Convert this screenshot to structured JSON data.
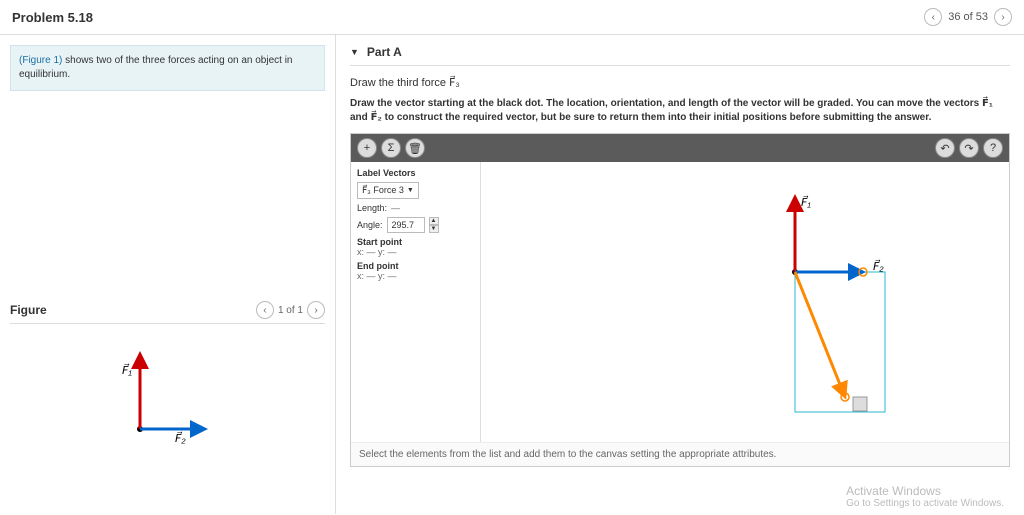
{
  "header": {
    "title": "Problem 5.18",
    "page_of": "36 of 53"
  },
  "left": {
    "info_link": "(Figure 1)",
    "info_rest": " shows two of the three forces acting on an object in equilibrium.",
    "figure_heading": "Figure",
    "figure_pager": "1 of 1",
    "f1_label": "F⃗₁",
    "f2_label": "F⃗₂"
  },
  "part": {
    "label": "Part A",
    "prompt": "Draw the third force F⃗₃",
    "instruction_a": "Draw the vector starting at the black dot. The location, orientation, and length of the vector will be graded. You can move the vectors ",
    "v1": "F⃗₁",
    "mid": " and ",
    "v2": "F⃗₂",
    "instruction_b": " to construct the required vector, but be sure to return them into their initial positions before submitting the answer."
  },
  "toolbar": {
    "add": "+",
    "sum": "Σ",
    "del": "🗑",
    "undo": "↶",
    "redo": "↷",
    "help": "?"
  },
  "panel": {
    "label_vectors": "Label Vectors",
    "vector_sel": "F⃗₃ Force 3",
    "length_label": "Length:",
    "length_val": "—",
    "angle_label": "Angle:",
    "angle_val": "295.7",
    "start_label": "Start point",
    "start_xy": "x: — y: —",
    "end_label": "End point",
    "end_xy": "x: — y: —"
  },
  "canvas": {
    "f1": "F⃗₁",
    "f2": "F⃗₂"
  },
  "hint": "Select the elements from the list and add them to the canvas setting the appropriate attributes.",
  "watermark": {
    "title": "Activate Windows",
    "sub": "Go to Settings to activate Windows."
  }
}
